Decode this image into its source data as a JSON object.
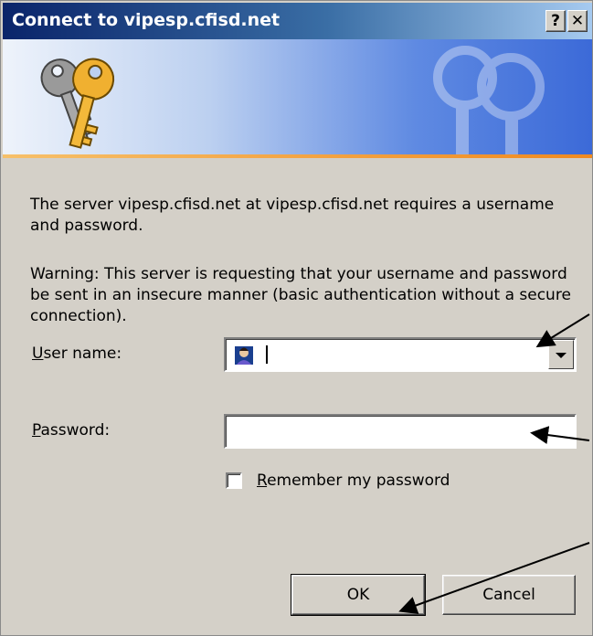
{
  "window": {
    "title": "Connect to vipesp.cfisd.net",
    "help_button": "?",
    "close_button": "✕"
  },
  "message": {
    "line1": "The server vipesp.cfisd.net at vipesp.cfisd.net requires a username and password.",
    "warning": "Warning: This server is requesting that your username and password be sent in an insecure manner (basic authentication without a secure connection)."
  },
  "fields": {
    "username_label_prefix": "U",
    "username_label_rest": "ser name:",
    "username_value": "",
    "password_label_prefix": "P",
    "password_label_rest": "assword:",
    "password_value": ""
  },
  "remember": {
    "label_prefix": "R",
    "label_rest": "emember my password",
    "checked": false
  },
  "buttons": {
    "ok": "OK",
    "cancel": "Cancel"
  },
  "colors": {
    "titlebar_start": "#0a246a",
    "dialog_bg": "#d4d0c8",
    "annotation_arrow": "#000000"
  }
}
